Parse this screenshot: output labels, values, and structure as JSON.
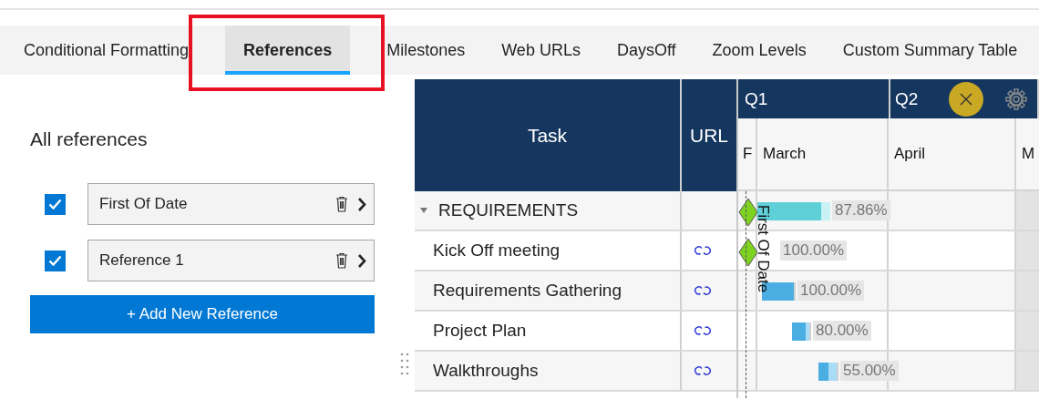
{
  "tabs": [
    {
      "label": "Conditional Formatting",
      "selected": false,
      "highlighted": false
    },
    {
      "label": "References",
      "selected": true,
      "highlighted": true
    },
    {
      "label": "Milestones",
      "selected": false,
      "highlighted": false
    },
    {
      "label": "Web URLs",
      "selected": false,
      "highlighted": false
    },
    {
      "label": "DaysOff",
      "selected": false,
      "highlighted": false
    },
    {
      "label": "Zoom Levels",
      "selected": false,
      "highlighted": false
    },
    {
      "label": "Custom Summary Table",
      "selected": false,
      "highlighted": false
    }
  ],
  "references_panel": {
    "title": "All references",
    "references": [
      {
        "name": "First Of Date",
        "checked": true
      },
      {
        "name": "Reference 1",
        "checked": true
      }
    ],
    "add_button": "+ Add New Reference"
  },
  "gantt": {
    "columns": [
      "Task",
      "URL"
    ],
    "quarters": [
      "Q1",
      "Q2"
    ],
    "months": [
      "F",
      "March",
      "April",
      "M"
    ],
    "reference_line": {
      "label": "First Of Date"
    },
    "rows": [
      {
        "task": "REQUIREMENTS",
        "kind": "group",
        "expanded": true,
        "has_url": false,
        "milestone": true,
        "level": 0.8786,
        "percent": "87.86%"
      },
      {
        "task": "Kick Off meeting",
        "kind": "task",
        "has_url": true,
        "milestone": true,
        "percent": "100.00%"
      },
      {
        "task": "Requirements Gathering",
        "kind": "task",
        "has_url": true,
        "milestone": false,
        "level": 1,
        "percent": "100.00%"
      },
      {
        "task": "Project Plan",
        "kind": "task",
        "has_url": true,
        "milestone": false,
        "level": 0.8,
        "percent": "80.00%"
      },
      {
        "task": "Walkthroughs",
        "kind": "task",
        "has_url": true,
        "milestone": false,
        "level": 0.55,
        "percent": "55.00%"
      }
    ]
  }
}
